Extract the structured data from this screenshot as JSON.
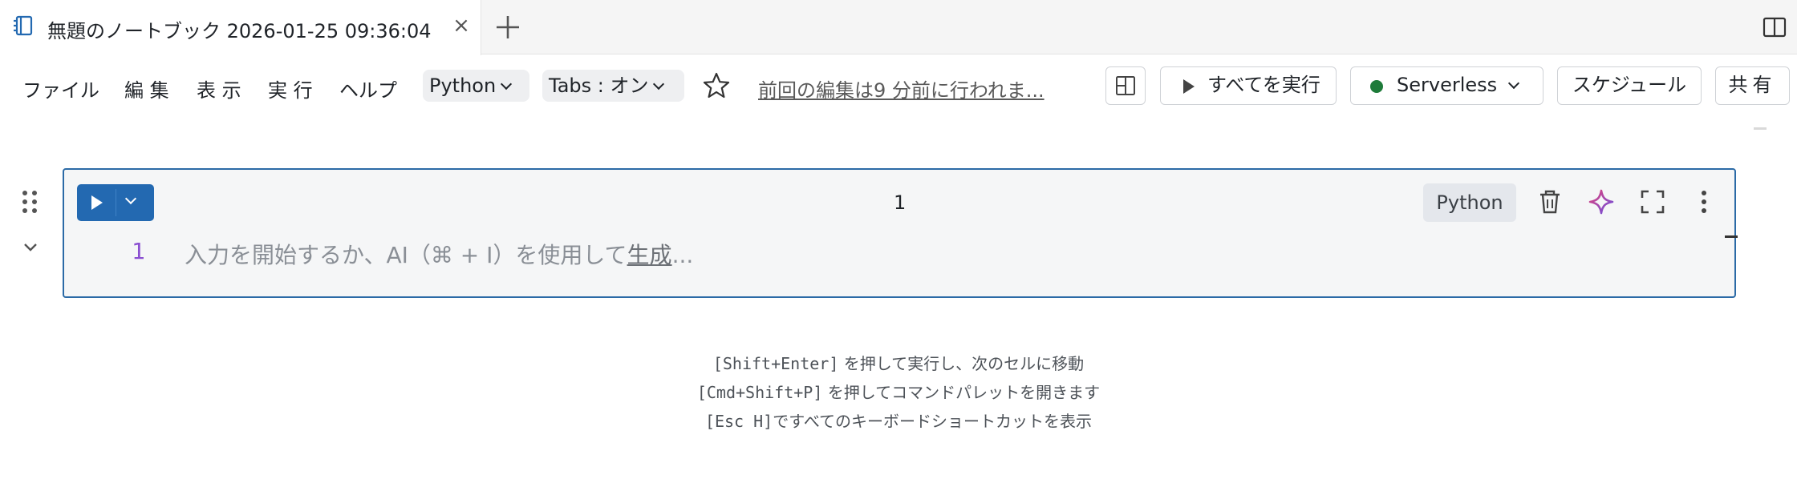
{
  "tab": {
    "title": "無題のノートブック 2026-01-25 09:36:04",
    "close": "×"
  },
  "menu": {
    "file": "ファイル",
    "edit": "編 集",
    "view": "表 示",
    "run": "実 行",
    "help": "ヘルプ"
  },
  "toolbar": {
    "language": "Python",
    "tabs": "Tabs : オン",
    "last_edit": "前回の編集は9 分前に行われま...",
    "run_all": "すべてを実行",
    "compute": "Serverless",
    "schedule": "スケジュール",
    "share": "共有"
  },
  "cell": {
    "number": "1",
    "language": "Python",
    "line_number": "1",
    "placeholder_prefix": "入力を開始するか、AI（⌘ + I）を使用して",
    "placeholder_link": "生成",
    "placeholder_suffix": "..."
  },
  "hints": [
    {
      "key": "[Shift+Enter]",
      "text": " を押して実行し、次のセルに移動"
    },
    {
      "key": "[Cmd+Shift+P]",
      "text": " を押してコマンドパレットを開きます"
    },
    {
      "key": "[Esc H]",
      "text": "ですべてのキーボードショートカットを表示"
    }
  ],
  "colors": {
    "accent": "#2369b1",
    "cell_border": "#2b6aa6",
    "compute_status": "#1e7b3a",
    "line_number": "#8a4fd1"
  },
  "icons": {
    "notebook": "notebook-icon",
    "new_tab": "plus-icon",
    "layout": "sidebar-layout-icon",
    "favorite": "star-icon",
    "delete": "trash-icon",
    "assistant": "sparkle-icon",
    "fullscreen": "expand-icon",
    "more": "kebab-icon",
    "drag": "drag-handle-icon",
    "collapse": "chevron-down-icon"
  }
}
